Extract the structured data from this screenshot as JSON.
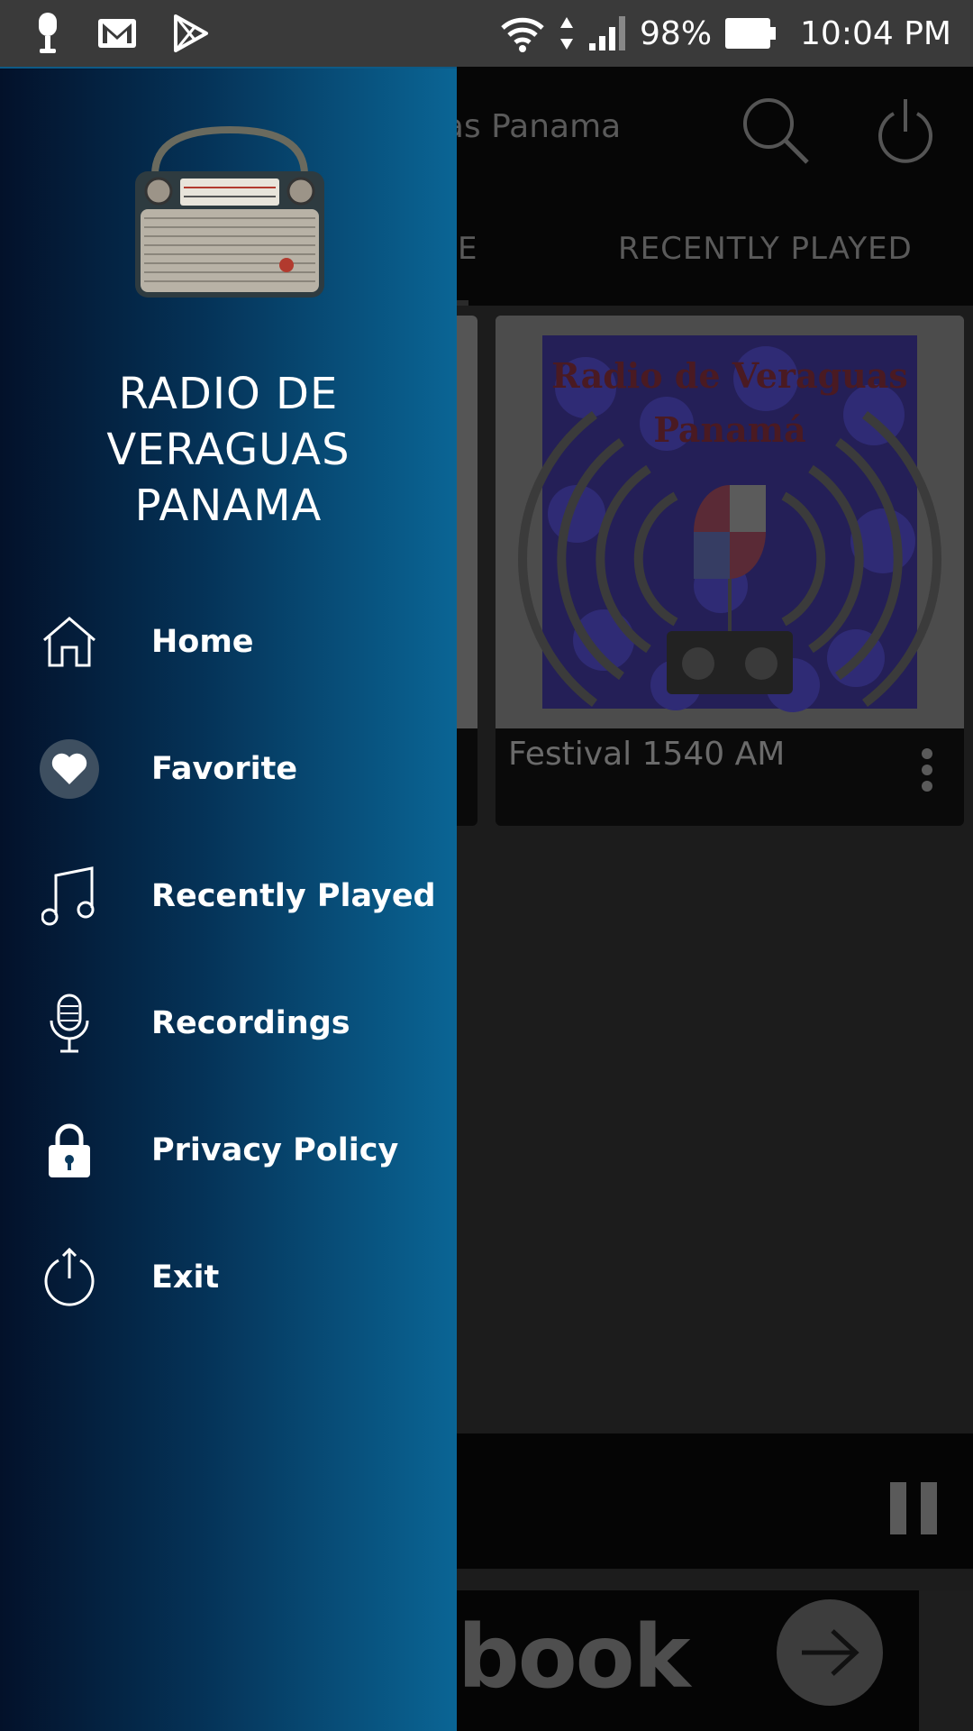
{
  "status_bar": {
    "battery": "98%",
    "time": "10:04 PM"
  },
  "app": {
    "title": "uas Panama",
    "tabs": [
      "E",
      "RECENTLY PLAYED"
    ],
    "station_card": {
      "name": "Festival 1540 AM"
    },
    "ad": {
      "text": "book"
    }
  },
  "drawer": {
    "title": "RADIO DE VERAGUAS PANAMA",
    "menu": [
      {
        "label": "Home",
        "icon": "home-icon"
      },
      {
        "label": "Favorite",
        "icon": "heart-icon"
      },
      {
        "label": "Recently Played",
        "icon": "music-note-icon"
      },
      {
        "label": "Recordings",
        "icon": "microphone-icon"
      },
      {
        "label": "Privacy Policy",
        "icon": "lock-icon"
      },
      {
        "label": "Exit",
        "icon": "power-icon"
      }
    ]
  },
  "colors": {
    "drawer_gradient_start": "#03112a",
    "drawer_gradient_end": "#0a6595",
    "status_bar": "#3a3a3a"
  }
}
